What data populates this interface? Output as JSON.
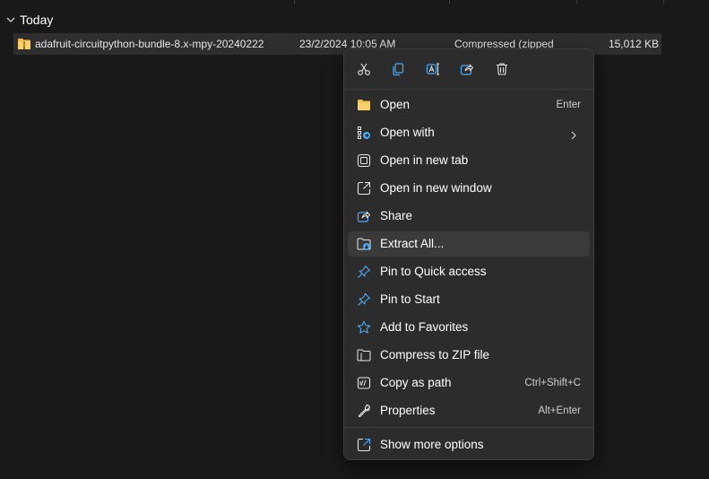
{
  "group": {
    "title": "Today"
  },
  "file": {
    "name": "adafruit-circuitpython-bundle-8.x-mpy-20240222",
    "date": "23/2/2024 10:05 AM",
    "type": "Compressed (zipped) F",
    "size": "15,012 KB",
    "icon": "zip-folder-icon"
  },
  "menu": {
    "quick_actions": [
      {
        "name": "cut",
        "icon": "scissors-icon"
      },
      {
        "name": "copy",
        "icon": "copy-icon"
      },
      {
        "name": "rename",
        "icon": "rename-icon"
      },
      {
        "name": "share",
        "icon": "share-icon"
      },
      {
        "name": "delete",
        "icon": "trash-icon"
      }
    ],
    "items": [
      {
        "label": "Open",
        "accelerator": "Enter",
        "icon": "folder-icon"
      },
      {
        "label": "Open with",
        "accelerator": "",
        "icon": "open-with-icon",
        "submenu": true
      },
      {
        "label": "Open in new tab",
        "accelerator": "",
        "icon": "new-tab-icon"
      },
      {
        "label": "Open in new window",
        "accelerator": "",
        "icon": "new-window-icon"
      },
      {
        "label": "Share",
        "accelerator": "",
        "icon": "share-icon"
      },
      {
        "label": "Extract All...",
        "accelerator": "",
        "icon": "extract-icon"
      },
      {
        "label": "Pin to Quick access",
        "accelerator": "",
        "icon": "pin-icon"
      },
      {
        "label": "Pin to Start",
        "accelerator": "",
        "icon": "pin-icon"
      },
      {
        "label": "Add to Favorites",
        "accelerator": "",
        "icon": "star-icon"
      },
      {
        "label": "Compress to ZIP file",
        "accelerator": "",
        "icon": "zip-icon"
      },
      {
        "label": "Copy as path",
        "accelerator": "Ctrl+Shift+C",
        "icon": "copy-path-icon"
      },
      {
        "label": "Properties",
        "accelerator": "Alt+Enter",
        "icon": "wrench-icon"
      }
    ],
    "more": {
      "label": "Show more options",
      "icon": "more-options-icon"
    }
  },
  "colors": {
    "background": "#191919",
    "menu_bg": "#2c2c2c",
    "selected_row": "#2e2e2e",
    "highlight": "#3a3a3a",
    "accent_blue": "#4ea8f2",
    "folder_yellow": "#f4c048"
  }
}
